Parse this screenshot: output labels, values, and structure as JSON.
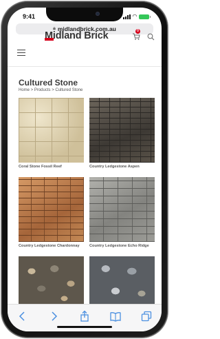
{
  "status_bar": {
    "time": "9:41"
  },
  "browser": {
    "url": "midlandbrick.com.au"
  },
  "site": {
    "logo_text": "Midland Brick",
    "cart_count": "0",
    "accent_color": "#d6001c"
  },
  "page": {
    "title": "Cultured Stone",
    "breadcrumb": "Home > Products > Cultured Stone"
  },
  "products": [
    {
      "name": "Coral Stone Fossil Reef"
    },
    {
      "name": "Country Ledgestone Aspen"
    },
    {
      "name": "Country Ledgestone Chardonnay"
    },
    {
      "name": "Country Ledgestone Echo Ridge"
    },
    {
      "name": ""
    },
    {
      "name": ""
    }
  ],
  "toolbar": {
    "icons": [
      "back-icon",
      "forward-icon",
      "share-icon",
      "bookmarks-icon",
      "tabs-icon"
    ]
  }
}
